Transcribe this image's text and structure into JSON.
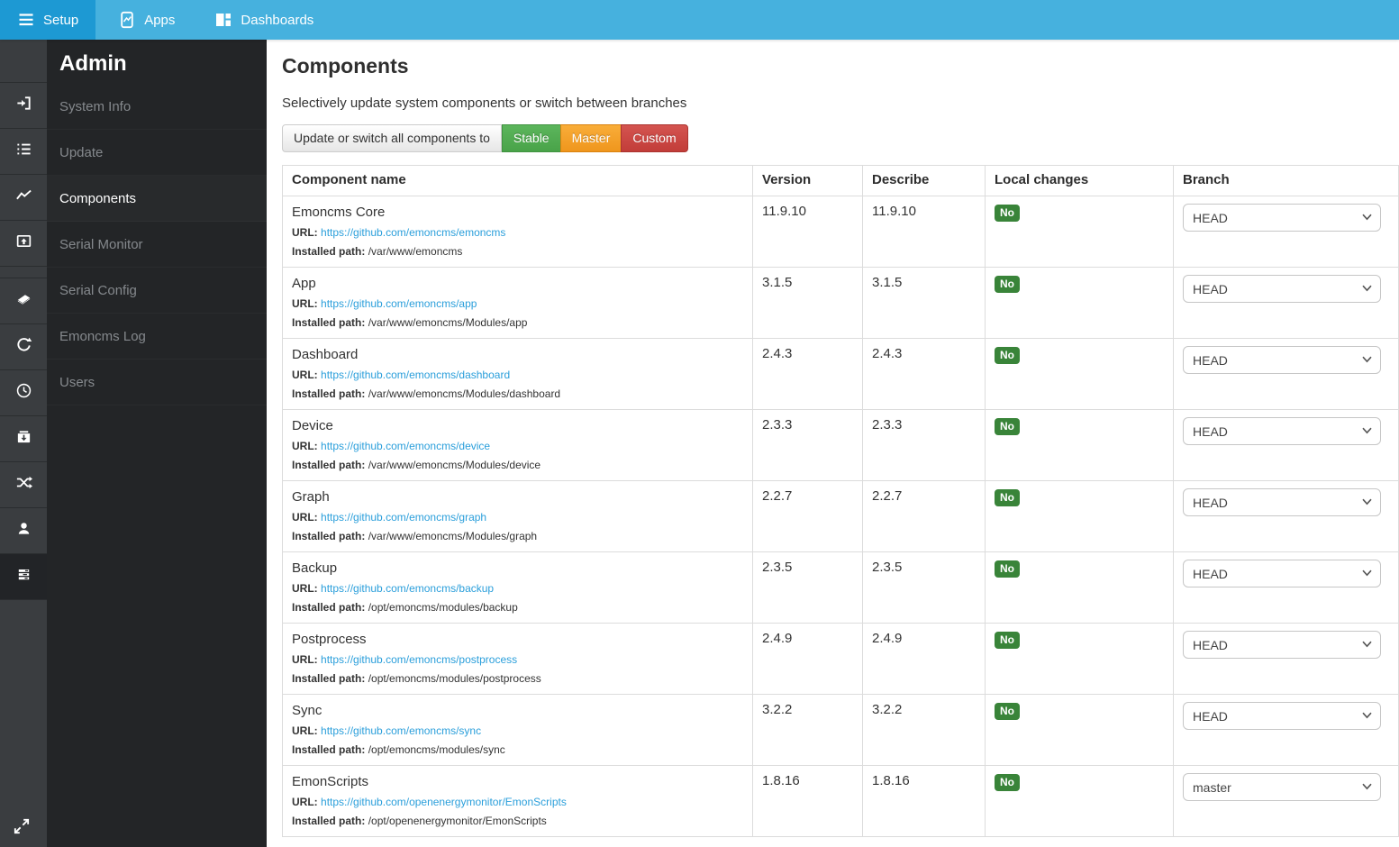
{
  "topbar": {
    "tabs": [
      {
        "label": "Setup",
        "icon": "hamburger-icon",
        "active": true
      },
      {
        "label": "Apps",
        "icon": "apps-icon",
        "active": false
      },
      {
        "label": "Dashboards",
        "icon": "dashboards-icon",
        "active": false
      }
    ]
  },
  "sidebar": {
    "title": "Admin",
    "items": [
      {
        "label": "System Info",
        "active": false
      },
      {
        "label": "Update",
        "active": false
      },
      {
        "label": "Components",
        "active": true
      },
      {
        "label": "Serial Monitor",
        "active": false
      },
      {
        "label": "Serial Config",
        "active": false
      },
      {
        "label": "Emoncms Log",
        "active": false
      },
      {
        "label": "Users",
        "active": false
      }
    ],
    "icon_items": [
      "input-icon",
      "feed-list-icon",
      "graph-icon",
      "visualisation-icon",
      "divider",
      "database-icon",
      "sync-refresh-icon",
      "clock-icon",
      "backup-icon",
      "shuffle-icon",
      "user-icon",
      "admin-server-icon"
    ],
    "active_icon": "admin-server-icon",
    "expand_icon": "expand-icon"
  },
  "main": {
    "title": "Components",
    "subtitle": "Selectively update system components or switch between branches",
    "actions": {
      "label_button": "Update or switch all components to",
      "buttons": [
        {
          "label": "Stable",
          "style": "btn-stable",
          "color": "#4fa84f"
        },
        {
          "label": "Master",
          "style": "btn-master",
          "color": "#f3a22b"
        },
        {
          "label": "Custom",
          "style": "btn-custom",
          "color": "#cb4743"
        }
      ]
    },
    "table": {
      "headers": [
        "Component name",
        "Version",
        "Describe",
        "Local changes",
        "Branch"
      ],
      "url_label": "URL:",
      "path_label": "Installed path:",
      "badge_color": "#398439",
      "rows": [
        {
          "name": "Emoncms Core",
          "url": "https://github.com/emoncms/emoncms",
          "path": "/var/www/emoncms",
          "version": "11.9.10",
          "describe": "11.9.10",
          "local_changes": "No",
          "branch": "HEAD"
        },
        {
          "name": "App",
          "url": "https://github.com/emoncms/app",
          "path": "/var/www/emoncms/Modules/app",
          "version": "3.1.5",
          "describe": "3.1.5",
          "local_changes": "No",
          "branch": "HEAD"
        },
        {
          "name": "Dashboard",
          "url": "https://github.com/emoncms/dashboard",
          "path": "/var/www/emoncms/Modules/dashboard",
          "version": "2.4.3",
          "describe": "2.4.3",
          "local_changes": "No",
          "branch": "HEAD"
        },
        {
          "name": "Device",
          "url": "https://github.com/emoncms/device",
          "path": "/var/www/emoncms/Modules/device",
          "version": "2.3.3",
          "describe": "2.3.3",
          "local_changes": "No",
          "branch": "HEAD"
        },
        {
          "name": "Graph",
          "url": "https://github.com/emoncms/graph",
          "path": "/var/www/emoncms/Modules/graph",
          "version": "2.2.7",
          "describe": "2.2.7",
          "local_changes": "No",
          "branch": "HEAD"
        },
        {
          "name": "Backup",
          "url": "https://github.com/emoncms/backup",
          "path": "/opt/emoncms/modules/backup",
          "version": "2.3.5",
          "describe": "2.3.5",
          "local_changes": "No",
          "branch": "HEAD"
        },
        {
          "name": "Postprocess",
          "url": "https://github.com/emoncms/postprocess",
          "path": "/opt/emoncms/modules/postprocess",
          "version": "2.4.9",
          "describe": "2.4.9",
          "local_changes": "No",
          "branch": "HEAD"
        },
        {
          "name": "Sync",
          "url": "https://github.com/emoncms/sync",
          "path": "/opt/emoncms/modules/sync",
          "version": "3.2.2",
          "describe": "3.2.2",
          "local_changes": "No",
          "branch": "HEAD"
        },
        {
          "name": "EmonScripts",
          "url": "https://github.com/openenergymonitor/EmonScripts",
          "path": "/opt/openenergymonitor/EmonScripts",
          "version": "1.8.16",
          "describe": "1.8.16",
          "local_changes": "No",
          "branch": "master"
        }
      ]
    }
  }
}
